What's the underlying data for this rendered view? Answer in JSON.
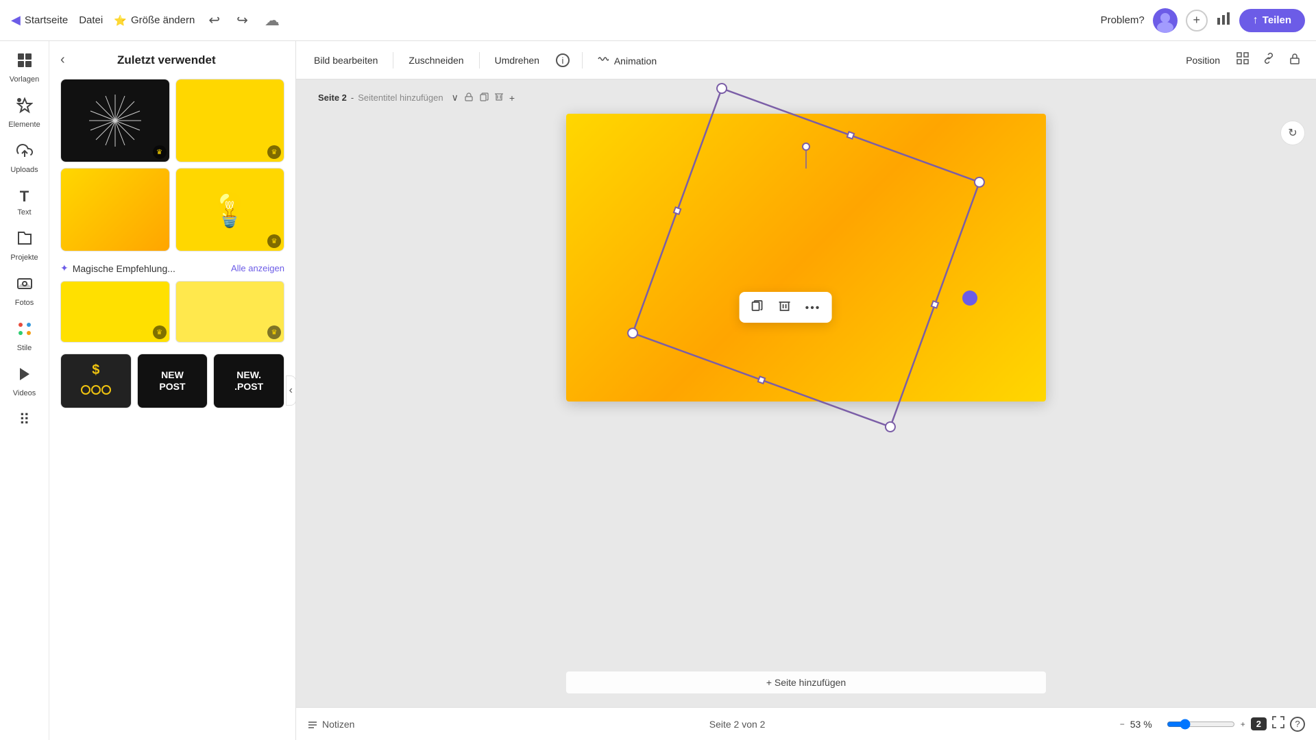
{
  "topbar": {
    "home_label": "Startseite",
    "file_label": "Datei",
    "resize_label": "Größe ändern",
    "resize_icon": "⭐",
    "undo_icon": "↩",
    "redo_icon": "↪",
    "cloud_icon": "☁",
    "problem_label": "Problem?",
    "add_user_icon": "+",
    "stats_icon": "📊",
    "share_icon": "↑",
    "share_label": "Teilen"
  },
  "sidebar_icons": [
    {
      "id": "vorlagen",
      "icon": "⊞",
      "label": "Vorlagen"
    },
    {
      "id": "elemente",
      "icon": "✦",
      "label": "Elemente"
    },
    {
      "id": "uploads",
      "icon": "⬆",
      "label": "Uploads"
    },
    {
      "id": "text",
      "icon": "T",
      "label": "Text"
    },
    {
      "id": "projekte",
      "icon": "📁",
      "label": "Projekte"
    },
    {
      "id": "fotos",
      "icon": "🌄",
      "label": "Fotos"
    },
    {
      "id": "stile",
      "icon": "🎨",
      "label": "Stile"
    },
    {
      "id": "videos",
      "icon": "▶",
      "label": "Videos"
    },
    {
      "id": "more",
      "icon": "⠿",
      "label": ""
    }
  ],
  "sidebar_panel": {
    "title": "Zuletzt verwendet",
    "back_icon": "<",
    "magic_section": {
      "label": "Magische Empfehlung...",
      "magic_icon": "✦",
      "show_all": "Alle anzeigen"
    }
  },
  "toolbar": {
    "edit_image": "Bild bearbeiten",
    "crop": "Zuschneiden",
    "flip": "Umdrehen",
    "info_icon": "ℹ",
    "animation": "Animation",
    "position": "Position",
    "filter_icon": "⊞",
    "link_icon": "🔗",
    "lock_icon": "🔒"
  },
  "canvas": {
    "page_label": "Seite 2",
    "page_dash": " - ",
    "page_subtitle": "Seitentitel hinzufügen",
    "add_page": "+ Seite hinzufügen"
  },
  "context_menu": {
    "copy_icon": "⧉",
    "delete_icon": "🗑",
    "more_icon": "•••"
  },
  "bottombar": {
    "notes_icon": "≡",
    "notes_label": "Notizen",
    "page_info": "Seite 2 von 2",
    "zoom_percent": "53 %",
    "page_badge": "2",
    "fullscreen_icon": "⛶",
    "help_icon": "?"
  }
}
